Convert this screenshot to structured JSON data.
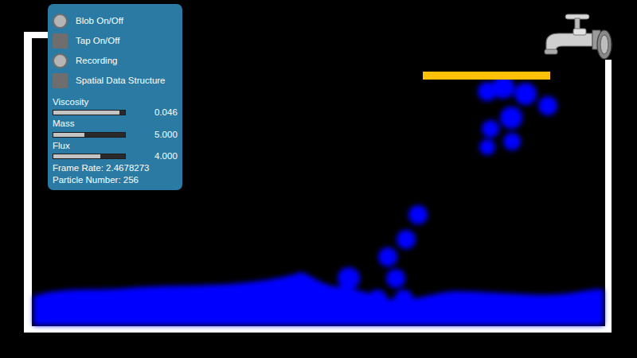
{
  "panel": {
    "toggles": [
      {
        "label": "Blob On/Off",
        "kind": "round",
        "on": false
      },
      {
        "label": "Tap On/Off",
        "kind": "square",
        "on": false
      },
      {
        "label": "Recording",
        "kind": "round",
        "on": false
      },
      {
        "label": "Spatial Data Structure",
        "kind": "square",
        "on": false
      }
    ],
    "sliders": [
      {
        "label": "Viscosity",
        "level": 0.92,
        "reading": "0.046"
      },
      {
        "label": "Mass",
        "level": 0.43,
        "reading": "5.000"
      },
      {
        "label": "Flux",
        "level": 0.65,
        "reading": "4.000"
      }
    ],
    "stats": [
      "Frame Rate: 2.4678273",
      "Particle Number: 256"
    ]
  }
}
